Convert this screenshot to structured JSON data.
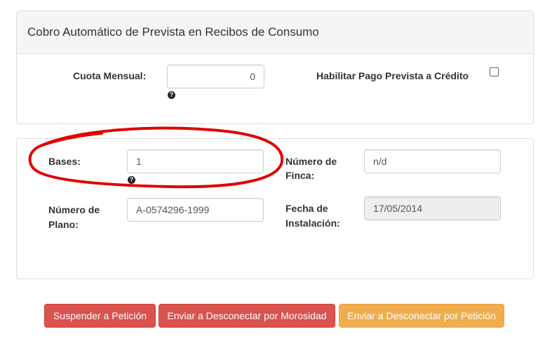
{
  "panel_prevista": {
    "title": "Cobro Automático de Prevista en Recibos de Consumo",
    "cuota_label": "Cuota Mensual:",
    "cuota_value": "0",
    "habilitar_label": "Habilitar Pago Prevista a Crédito",
    "habilitar_checked": false
  },
  "panel_info": {
    "bases_label": "Bases:",
    "bases_value": "1",
    "finca_label_line1": "Número de",
    "finca_label_line2": "Finca:",
    "finca_value": "n/d",
    "plano_label_line1": "Número de",
    "plano_label_line2": "Plano:",
    "plano_value": "A-0574296-1999",
    "fecha_label_line1": "Fecha de",
    "fecha_label_line2": "Instalación:",
    "fecha_value": "17/05/2014"
  },
  "help_glyph": "?",
  "buttons": {
    "suspender": "Suspender a Petición",
    "desconectar_morosidad": "Enviar a Desconectar por Morosidad",
    "desconectar_peticion": "Enviar a Desconectar por Petición"
  },
  "colors": {
    "danger": "#d9534f",
    "warning": "#f0ad4e",
    "annotation": "#e00000"
  }
}
